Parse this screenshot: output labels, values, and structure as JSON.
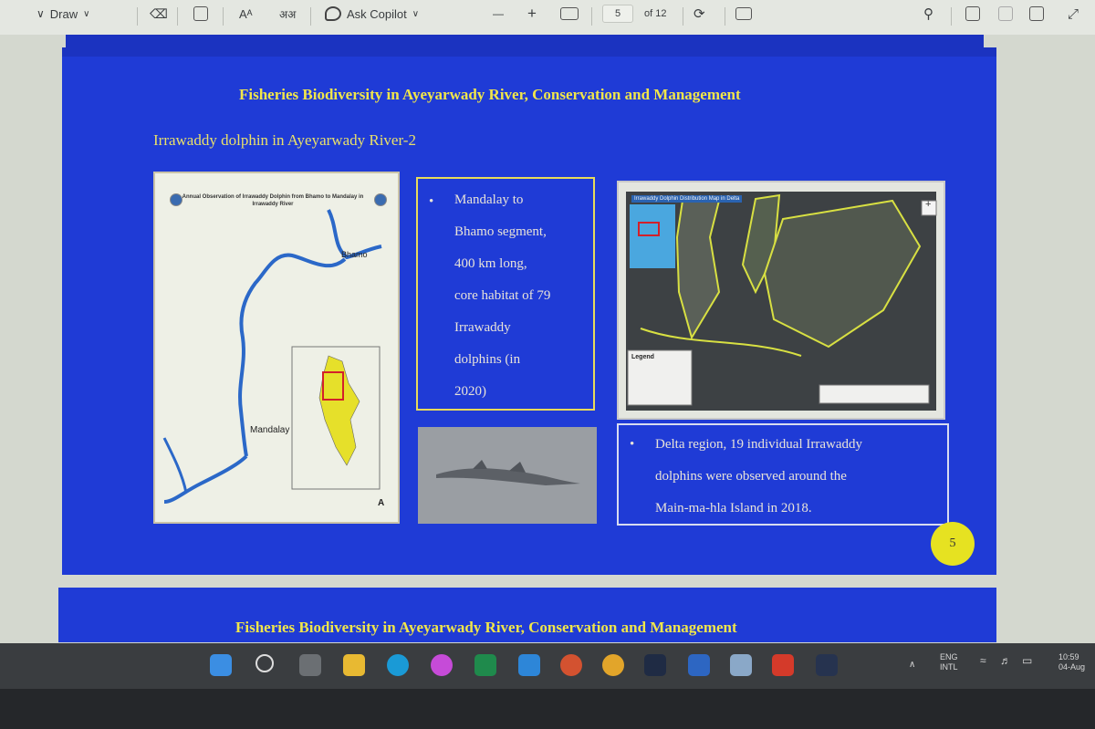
{
  "toolbar": {
    "draw_label": "Draw",
    "read_aloud_label": "Aᴬ",
    "translate_label": "अअ",
    "copilot_label": "Ask Copilot",
    "zoom_out": "—",
    "zoom_in": "+",
    "page_current": "5",
    "page_total": "of 12"
  },
  "slide1": {
    "title": "Fisheries Biodiversity in Ayeyarwady River, Conservation and Management",
    "subtitle": "Irrawaddy dolphin in Ayeyarwady River-2",
    "map1_title": "Annual Observation of Irrawaddy Dolphin from Bhamo to Mandalay in Irrawaddy River",
    "map1_label_bhamo": "Bhamo",
    "map1_label_mandalay": "Mandalay",
    "map1_north": "A",
    "box1_bullet": "•",
    "box1_lines": [
      "Mandalay to",
      "Bhamo segment,",
      "400 km long,",
      "core habitat of 79",
      "Irrawaddy",
      "dolphins (in",
      "2020)"
    ],
    "map2_title": "Irrawaddy Dolphin Distribution Map in Delta",
    "map2_legend_title": "Legend",
    "box2_bullet": "•",
    "box2_lines": [
      "Delta region, 19 individual Irrawaddy",
      "dolphins were observed around the",
      "Main-ma-hla Island in 2018."
    ],
    "page_badge": "5"
  },
  "slide2": {
    "title": "Fisheries Biodiversity in Ayeyarwady River, Conservation and Management"
  },
  "tray": {
    "lang1": "ENG",
    "lang2": "INTL",
    "time": "10:59",
    "date": "04-Aug"
  },
  "colors": {
    "slide_bg": "#1f3bd6",
    "title_yellow": "#f1e64a",
    "box_border": "#e8db5a"
  }
}
